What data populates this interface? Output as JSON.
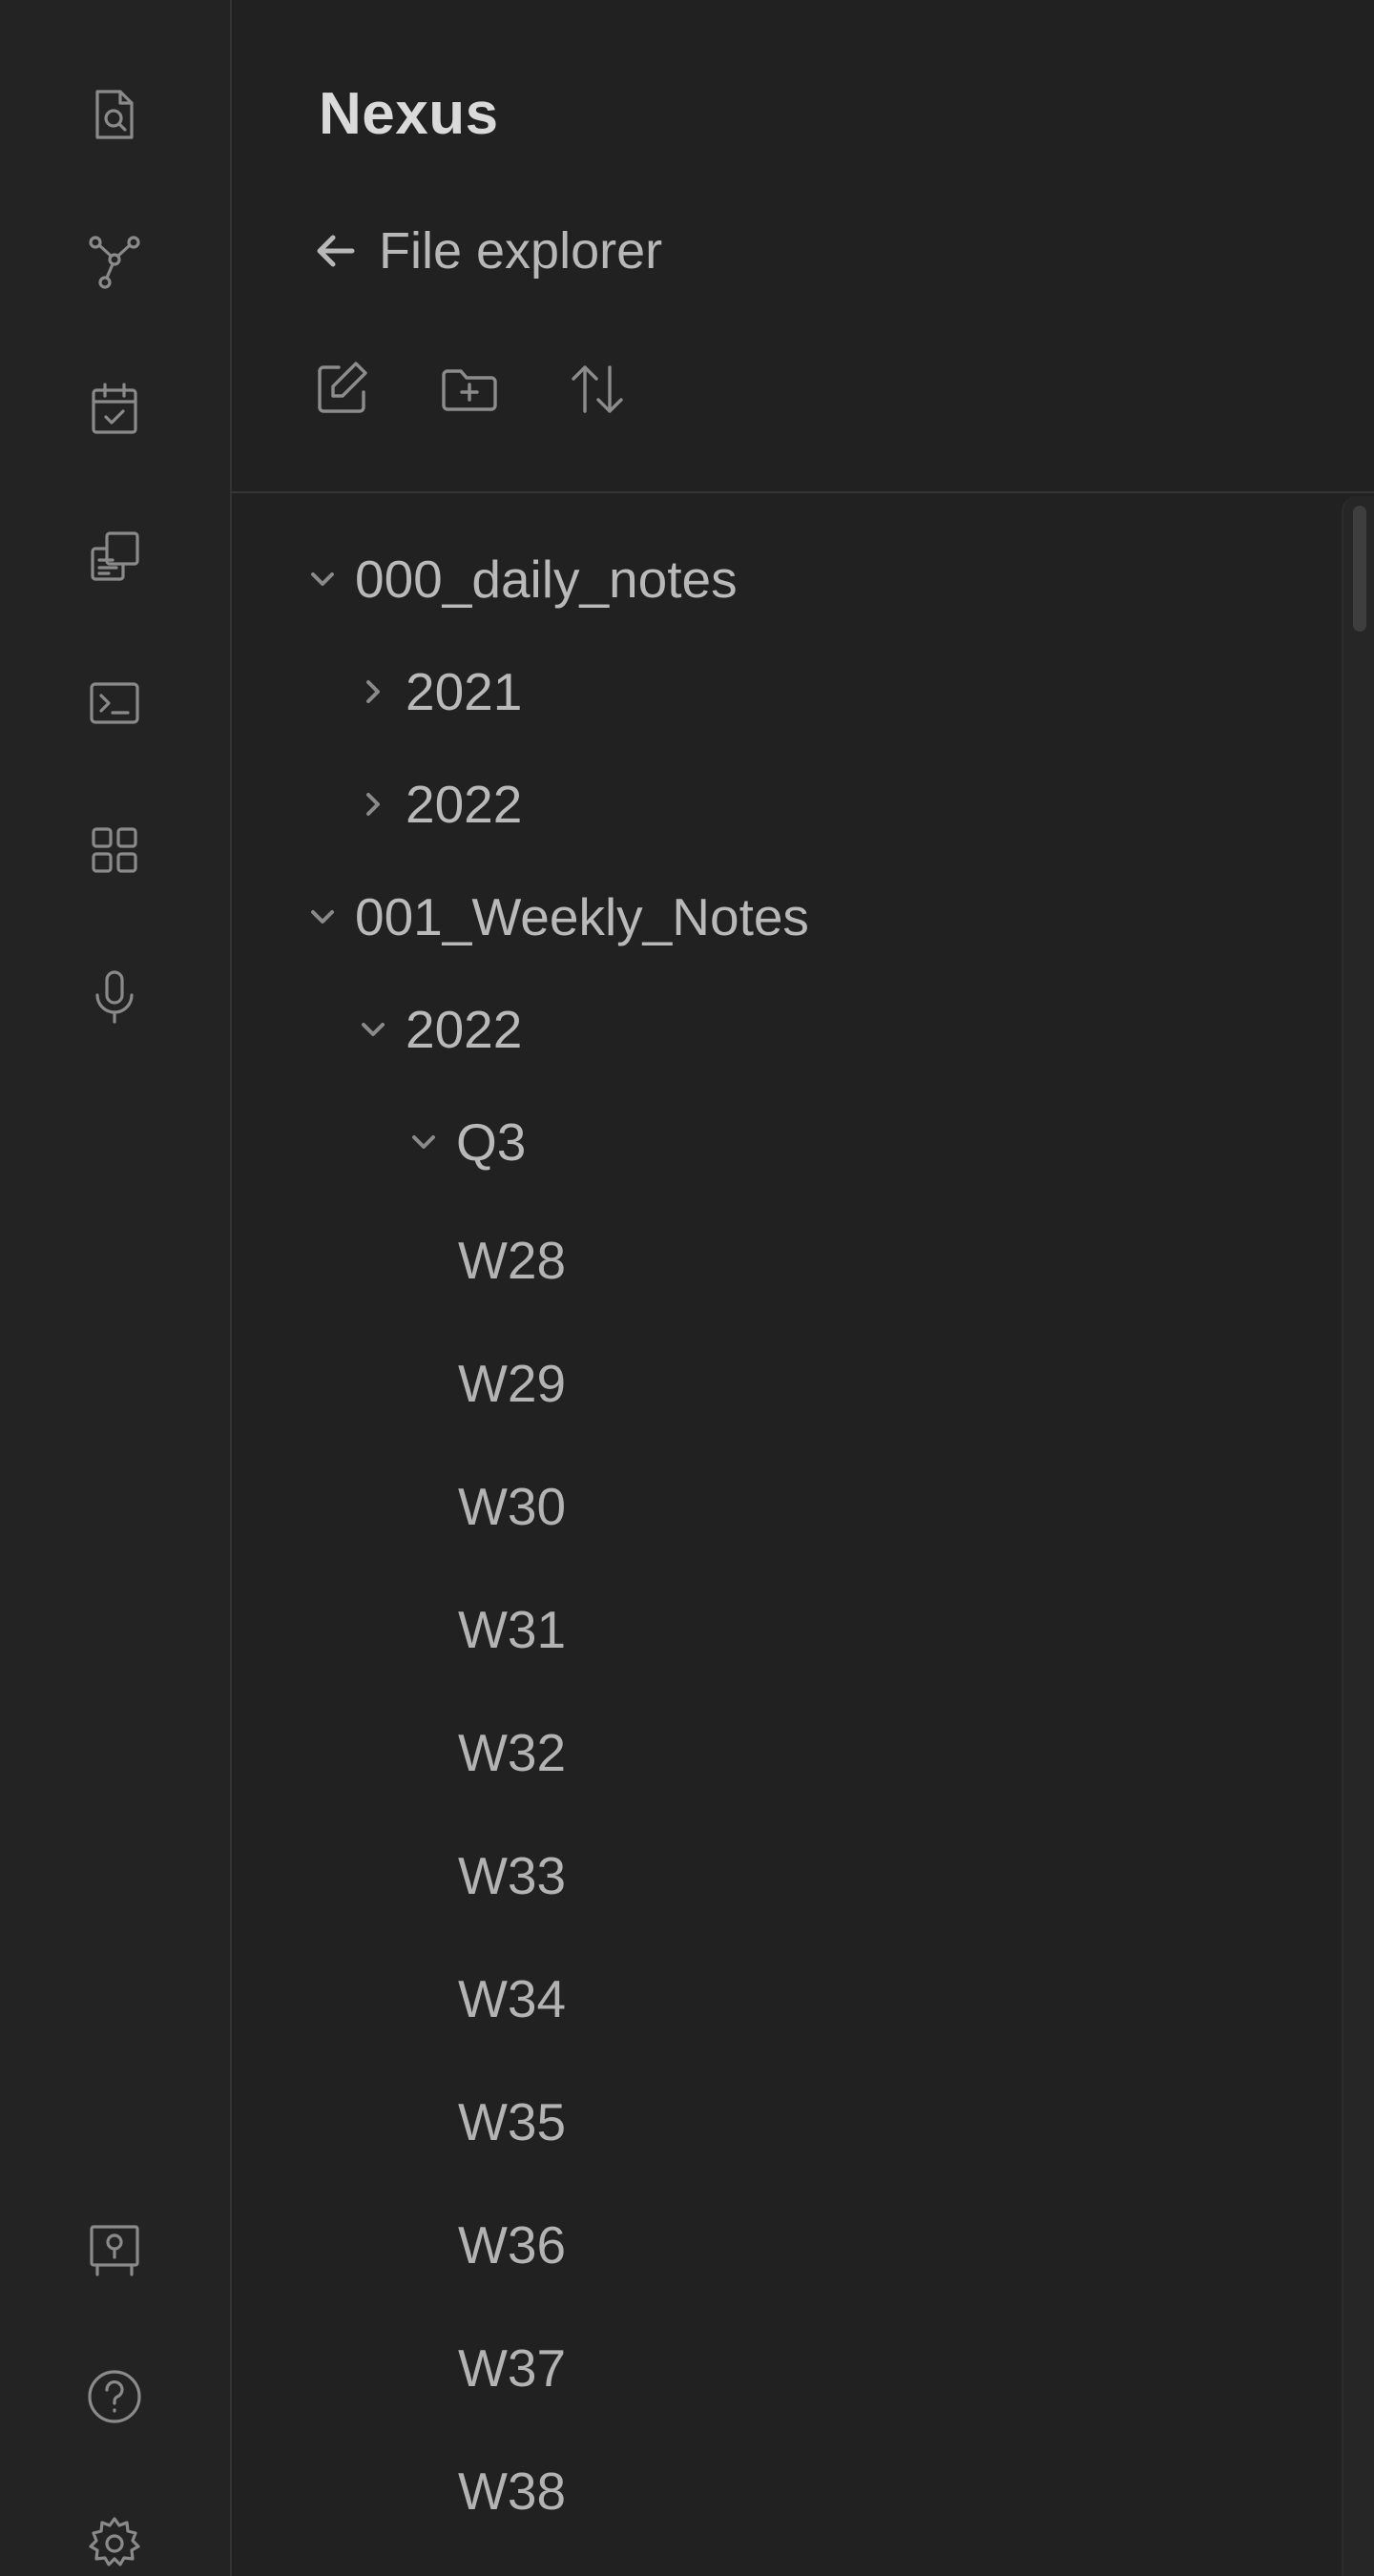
{
  "app": {
    "vault_name": "Nexus",
    "back_label": "File explorer",
    "accent_color": "#b9b9b9"
  },
  "ribbon": {
    "top": [
      "quick-switcher-icon",
      "graph-view-icon",
      "daily-note-icon",
      "templates-icon",
      "command-palette-icon",
      "plugins-icon",
      "audio-recorder-icon"
    ],
    "bottom": [
      "vault-switcher-icon",
      "help-icon",
      "settings-icon"
    ]
  },
  "toolbar": [
    "new-note-icon",
    "new-folder-icon",
    "sort-icon"
  ],
  "tree": {
    "items": [
      {
        "label": "000_daily_notes",
        "depth": 0,
        "type": "folder",
        "expanded": true
      },
      {
        "label": "2021",
        "depth": 1,
        "type": "folder",
        "expanded": false
      },
      {
        "label": "2022",
        "depth": 1,
        "type": "folder",
        "expanded": false
      },
      {
        "label": "001_Weekly_Notes",
        "depth": 0,
        "type": "folder",
        "expanded": true
      },
      {
        "label": "2022",
        "depth": 1,
        "type": "folder",
        "expanded": true
      },
      {
        "label": "Q3",
        "depth": 2,
        "type": "folder",
        "expanded": true
      },
      {
        "label": "W28",
        "depth": 3,
        "type": "file"
      },
      {
        "label": "W29",
        "depth": 3,
        "type": "file"
      },
      {
        "label": "W30",
        "depth": 3,
        "type": "file"
      },
      {
        "label": "W31",
        "depth": 3,
        "type": "file"
      },
      {
        "label": "W32",
        "depth": 3,
        "type": "file"
      },
      {
        "label": "W33",
        "depth": 3,
        "type": "file"
      },
      {
        "label": "W34",
        "depth": 3,
        "type": "file"
      },
      {
        "label": "W35",
        "depth": 3,
        "type": "file"
      },
      {
        "label": "W36",
        "depth": 3,
        "type": "file"
      },
      {
        "label": "W37",
        "depth": 3,
        "type": "file"
      },
      {
        "label": "W38",
        "depth": 3,
        "type": "file"
      }
    ]
  }
}
